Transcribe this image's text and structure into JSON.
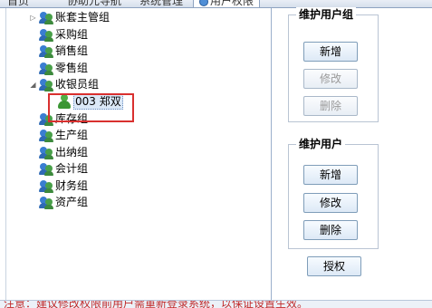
{
  "tabs": [
    {
      "label": "首页"
    },
    {
      "label": "协助元导航"
    },
    {
      "label": "系统管理"
    },
    {
      "label": "用户权限",
      "active": true
    }
  ],
  "tree": {
    "groups": [
      {
        "label": "账套主管组",
        "expander": "▷"
      },
      {
        "label": "采购组"
      },
      {
        "label": "销售组"
      },
      {
        "label": "零售组"
      },
      {
        "label": "收银员组",
        "expander": "◢"
      },
      {
        "label": "库存组"
      },
      {
        "label": "生产组"
      },
      {
        "label": "出纳组"
      },
      {
        "label": "会计组"
      },
      {
        "label": "财务组"
      },
      {
        "label": "资产组"
      }
    ],
    "user": {
      "label": "003 郑双"
    }
  },
  "maintain_group": {
    "title": "维护用户组",
    "add": "新增",
    "edit": "修改",
    "delete": "删除"
  },
  "maintain_user": {
    "title": "维护用户",
    "add": "新增",
    "edit": "修改",
    "delete": "删除"
  },
  "authorize": "授权",
  "status": "注意：建议修改权限前用户需重新登录系统，以保证设置生效。",
  "colors": {
    "highlight": "#d9302f",
    "accent": "#3a7ed1"
  }
}
